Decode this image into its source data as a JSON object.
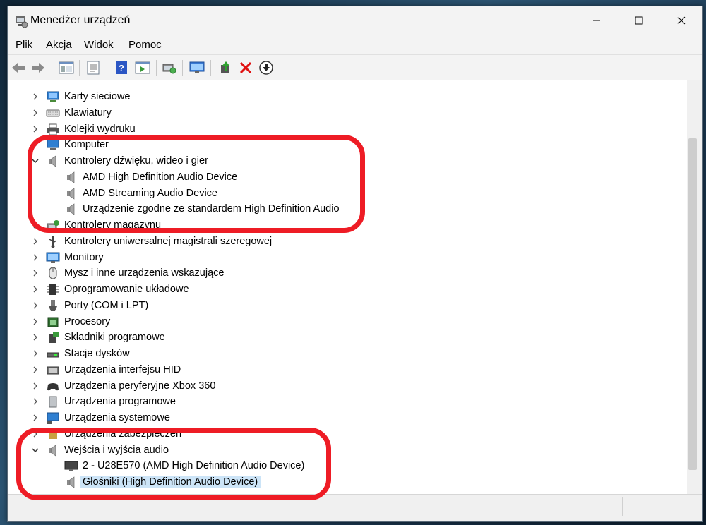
{
  "window": {
    "title": "Menedżer urządzeń"
  },
  "menu": [
    "Plik",
    "Akcja",
    "Widok",
    "Pomoc"
  ],
  "tree": [
    {
      "label": "Karty sieciowe",
      "icon": "network-adapter-icon",
      "expanded": false
    },
    {
      "label": "Klawiatury",
      "icon": "keyboard-icon",
      "expanded": false
    },
    {
      "label": "Kolejki wydruku",
      "icon": "printer-icon",
      "expanded": false
    },
    {
      "label": "Komputer",
      "icon": "computer-icon",
      "expanded": false
    },
    {
      "label": "Kontrolery dźwięku, wideo i gier",
      "icon": "speaker-icon",
      "expanded": true
    },
    {
      "label": "AMD High Definition Audio Device",
      "icon": "speaker-icon",
      "child": true
    },
    {
      "label": "AMD Streaming Audio Device",
      "icon": "speaker-icon",
      "child": true
    },
    {
      "label": "Urządzenie zgodne ze standardem High Definition Audio",
      "icon": "speaker-icon",
      "child": true
    },
    {
      "label": "Kontrolery magazynu",
      "icon": "storage-controller-icon",
      "expanded": false
    },
    {
      "label": "Kontrolery uniwersalnej magistrali szeregowej",
      "icon": "usb-icon",
      "expanded": false
    },
    {
      "label": "Monitory",
      "icon": "monitor-icon",
      "expanded": false
    },
    {
      "label": "Mysz i inne urządzenia wskazujące",
      "icon": "mouse-icon",
      "expanded": false
    },
    {
      "label": "Oprogramowanie układowe",
      "icon": "firmware-icon",
      "expanded": false
    },
    {
      "label": "Porty (COM i LPT)",
      "icon": "port-icon",
      "expanded": false
    },
    {
      "label": "Procesory",
      "icon": "processor-icon",
      "expanded": false
    },
    {
      "label": "Składniki programowe",
      "icon": "software-component-icon",
      "expanded": false
    },
    {
      "label": "Stacje dysków",
      "icon": "disk-drive-icon",
      "expanded": false
    },
    {
      "label": "Urządzenia interfejsu HID",
      "icon": "hid-icon",
      "expanded": false
    },
    {
      "label": "Urządzenia peryferyjne Xbox 360",
      "icon": "gamepad-icon",
      "expanded": false
    },
    {
      "label": "Urządzenia programowe",
      "icon": "software-device-icon",
      "expanded": false
    },
    {
      "label": "Urządzenia systemowe",
      "icon": "system-device-icon",
      "expanded": false
    },
    {
      "label": "Urządzenia zabezpieczeń",
      "icon": "security-device-icon",
      "expanded": false
    },
    {
      "label": "Wejścia i wyjścia audio",
      "icon": "speaker-icon",
      "expanded": true
    },
    {
      "label": "2 - U28E570 (AMD High Definition Audio Device)",
      "icon": "monitor-dark-icon",
      "child": true
    },
    {
      "label": "Głośniki (High Definition Audio Device)",
      "icon": "speaker-icon",
      "child": true,
      "selected": true
    }
  ],
  "colors": {
    "highlight": "#ee1c25",
    "selection": "#cce4f7"
  }
}
